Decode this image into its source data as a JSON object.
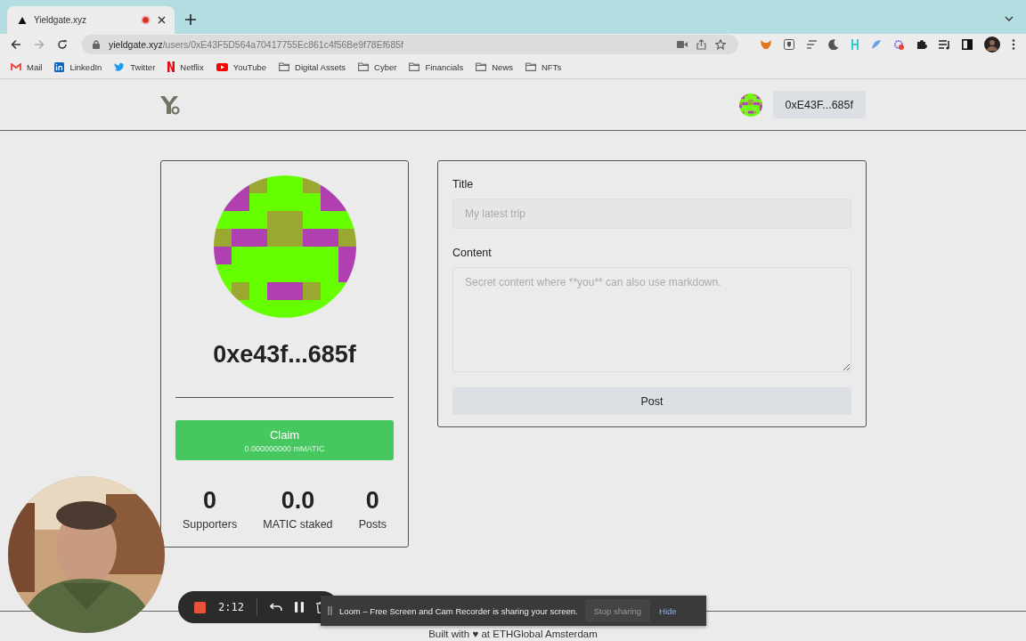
{
  "browser": {
    "tab": {
      "title": "Yieldgate.xyz",
      "recording": true
    },
    "url": {
      "host": "yieldgate.xyz",
      "path": "/users/0xE43F5D564a70417755Ec861c4f56Be9f78Ef685f"
    },
    "bookmarks": [
      {
        "label": "Mail",
        "kind": "mail"
      },
      {
        "label": "LinkedIn",
        "kind": "linkedin"
      },
      {
        "label": "Twitter",
        "kind": "twitter"
      },
      {
        "label": "Netflix",
        "kind": "netflix"
      },
      {
        "label": "YouTube",
        "kind": "youtube"
      },
      {
        "label": "Digital Assets",
        "kind": "folder"
      },
      {
        "label": "Cyber",
        "kind": "folder"
      },
      {
        "label": "Financials",
        "kind": "folder"
      },
      {
        "label": "News",
        "kind": "folder"
      },
      {
        "label": "NFTs",
        "kind": "folder"
      }
    ]
  },
  "header": {
    "account": "0xE43F...685f"
  },
  "profile": {
    "address": "0xe43f...685f",
    "claim": {
      "label": "Claim",
      "amount": "0.000000000 mMATIC"
    },
    "stats": [
      {
        "value": "0",
        "label": "Supporters"
      },
      {
        "value": "0.0",
        "label": "MATIC staked"
      },
      {
        "value": "0",
        "label": "Posts"
      }
    ]
  },
  "post_form": {
    "title_label": "Title",
    "title_placeholder": "My latest trip",
    "content_label": "Content",
    "content_placeholder": "Secret content where **you** can also use markdown.",
    "submit": "Post"
  },
  "footer": {
    "text": "Built with ♥ at ETHGlobal Amsterdam"
  },
  "recorder": {
    "time": "2:12",
    "notice": "Loom – Free Screen and Cam Recorder is sharing your screen.",
    "stop": "Stop sharing",
    "hide": "Hide"
  }
}
